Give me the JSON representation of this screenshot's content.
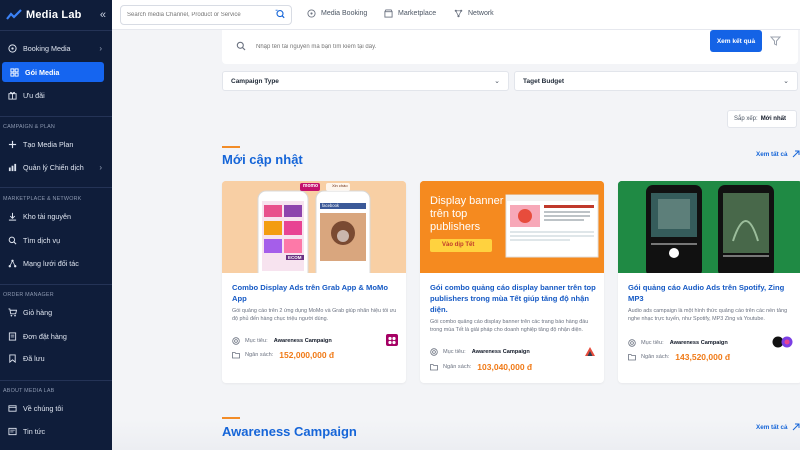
{
  "app": {
    "name": "Media Lab",
    "collapse_icon": "«"
  },
  "sidebar": {
    "items": [
      {
        "label": "Booking Media",
        "icon": "booking-icon",
        "chevron": "›"
      },
      {
        "label": "Gói Media",
        "icon": "package-icon",
        "active": true
      },
      {
        "label": "Ưu đãi",
        "icon": "offer-icon"
      }
    ],
    "sections": [
      {
        "title": "CAMPAIGN & PLAN",
        "items": [
          {
            "label": "Tạo Media Plan",
            "icon": "plus-icon"
          },
          {
            "label": "Quản lý Chiến dịch",
            "icon": "chart-icon",
            "chevron": "›"
          }
        ]
      },
      {
        "title": "MARKETPLACE & NETWORK",
        "items": [
          {
            "label": "Kho tài nguyên",
            "icon": "download-icon"
          },
          {
            "label": "Tìm dịch vụ",
            "icon": "search-icon"
          },
          {
            "label": "Mạng lưới đối tác",
            "icon": "network-icon"
          }
        ]
      },
      {
        "title": "ORDER MANAGER",
        "items": [
          {
            "label": "Giỏ hàng",
            "icon": "cart-icon"
          },
          {
            "label": "Đơn đặt hàng",
            "icon": "order-icon"
          },
          {
            "label": "Đã lưu",
            "icon": "bookmark-icon"
          }
        ]
      },
      {
        "title": "ABOUT MEDIA LAB",
        "items": [
          {
            "label": "Về chúng tôi",
            "icon": "about-icon"
          },
          {
            "label": "Tin tức",
            "icon": "news-icon"
          }
        ]
      }
    ]
  },
  "topbar": {
    "search_placeholder": "Search media Channel, Product or Service",
    "links": [
      {
        "label": "Media Booking",
        "icon": "booking-icon"
      },
      {
        "label": "Marketplace",
        "icon": "marketplace-icon"
      },
      {
        "label": "Network",
        "icon": "network-icon"
      }
    ]
  },
  "search": {
    "placeholder": "Nhập tên tài nguyên mà bạn tìm kiếm tại đây.",
    "button": "Xem kết quả"
  },
  "filters": {
    "campaign_type": "Campaign Type",
    "target_budget": "Taget Budget"
  },
  "sort": {
    "label": "Sắp xếp:",
    "value": "Mới nhất"
  },
  "sections": {
    "latest": {
      "title": "Mới cập nhật",
      "view_all": "Xem tất cả"
    },
    "awareness": {
      "title": "Awareness Campaign",
      "view_all": "Xem tất cả"
    }
  },
  "cards": [
    {
      "title": "Combo Display Ads trên Grab App & MoMo App",
      "desc": "Gói quảng cáo trên 2 ứng dụng MoMo và Grab giúp nhãn hiệu tối ưu độ phủ đến hàng chục triệu người dùng.",
      "goal_label": "Mục tiêu:",
      "goal": "Awareness Campaign",
      "budget_label": "Ngân sách:",
      "budget": "152,000,000 đ",
      "thumb_text": {
        "brand": "momo",
        "app": "facebook",
        "badge": "ECOM",
        "phone_greeting": "Xin chào"
      }
    },
    {
      "title": "Gói combo quảng cáo display banner trên top publishers trong mùa Tết giúp tăng độ nhận diện.",
      "desc": "Gói combo quảng cáo display banner trên các trang báo hàng đầu trong mùa Tết là giải pháp cho doanh nghiệp tăng độ nhận diện.",
      "goal_label": "Mục tiêu:",
      "goal": "Awareness Campaign",
      "budget_label": "Ngân sách:",
      "budget": "103,040,000 đ",
      "thumb_text": {
        "headline": "Display banner trên top publishers",
        "cta": "Vào dịp Tết"
      }
    },
    {
      "title": "Gói quảng cáo Audio Ads trên Spotify, Zing MP3",
      "desc": "Audio ads campaign là một hình thức quảng cáo trên các nền tảng nghe nhạc trực tuyến, như Spotify, MP3 Zing và Youtube.",
      "goal_label": "Mục tiêu:",
      "goal": "Awareness Campaign",
      "budget_label": "Ngân sách:",
      "budget": "143,520,000 đ",
      "thumb_text": {}
    }
  ],
  "colors": {
    "sidebar": "#0f1d3a",
    "accent": "#1565f0",
    "price": "#f07a17",
    "link": "#1565d8",
    "section_accent": "#f28c28"
  }
}
